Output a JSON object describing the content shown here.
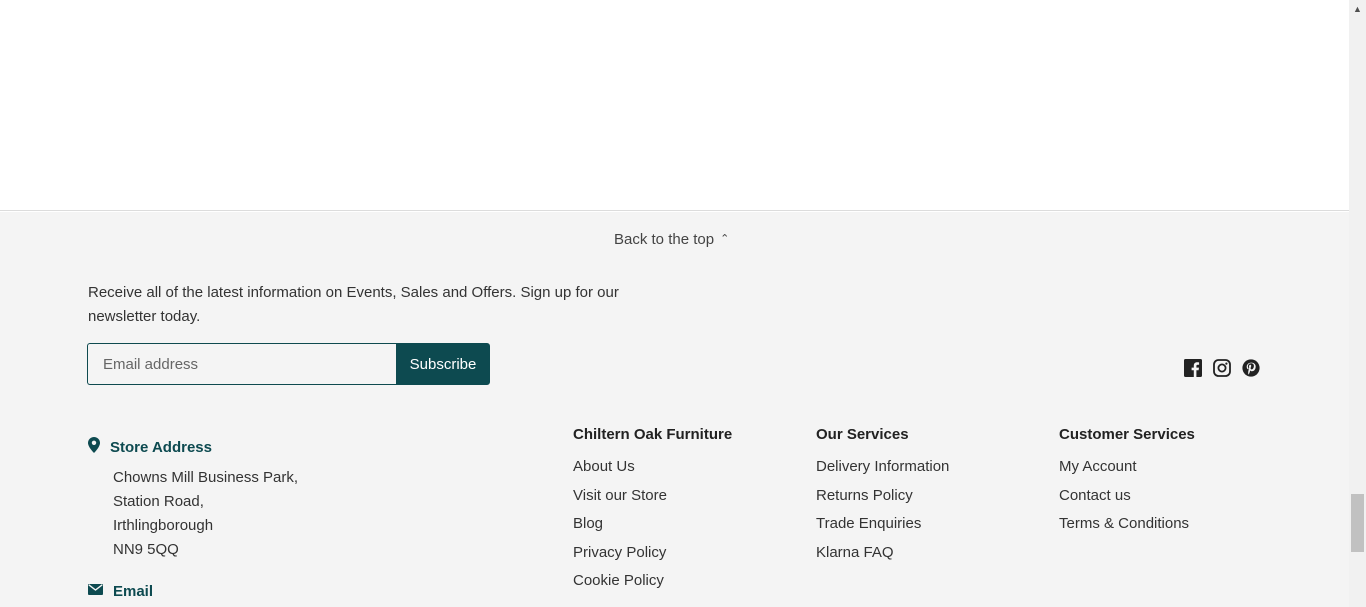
{
  "footer": {
    "back_to_top": "Back to the top",
    "newsletter": {
      "text": "Receive all of the latest information on Events, Sales and Offers. Sign up for our newsletter today.",
      "email_placeholder": "Email address",
      "email_value": "",
      "subscribe_label": "Subscribe"
    },
    "social": [
      {
        "name": "facebook-icon"
      },
      {
        "name": "instagram-icon"
      },
      {
        "name": "pinterest-icon"
      }
    ],
    "store": {
      "title": "Store Address",
      "address_lines": [
        "Chowns Mill Business Park,",
        "Station Road,",
        "Irthlingborough",
        "NN9 5QQ"
      ]
    },
    "email_contact": {
      "title": "Email"
    },
    "columns": [
      {
        "heading": "Chiltern Oak Furniture",
        "links": [
          "About Us",
          "Visit our Store",
          "Blog",
          "Privacy Policy",
          "Cookie Policy"
        ]
      },
      {
        "heading": "Our Services",
        "links": [
          "Delivery Information",
          "Returns Policy",
          "Trade Enquiries",
          "Klarna FAQ"
        ]
      },
      {
        "heading": "Customer Services",
        "links": [
          "My Account",
          "Contact us",
          "Terms & Conditions"
        ]
      }
    ]
  },
  "colors": {
    "accent": "#0d4a50",
    "footer_bg": "#f4f4f4",
    "text": "#333333"
  },
  "scrollbar": {
    "position_fraction": 0.95
  }
}
